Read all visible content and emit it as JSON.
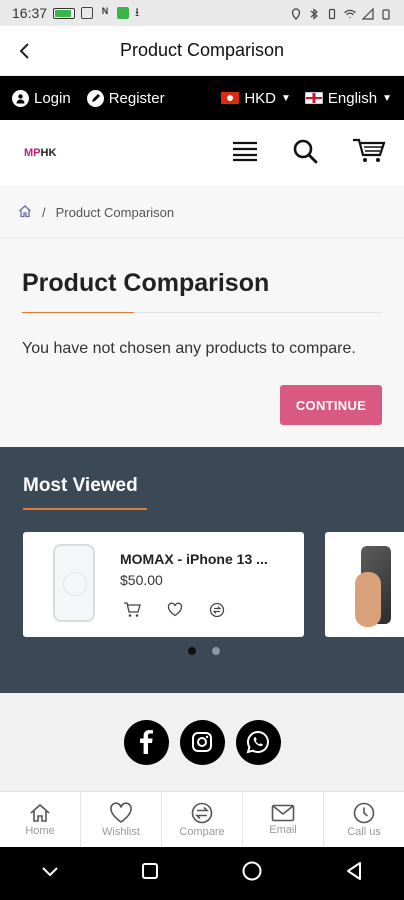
{
  "status_bar": {
    "time": "16:37"
  },
  "app_bar": {
    "title": "Product Comparison"
  },
  "top_bar": {
    "login_label": "Login",
    "register_label": "Register",
    "currency": "HKD",
    "language": "English"
  },
  "header": {
    "logo_text_m": "MP",
    "logo_text_hk": "HK"
  },
  "breadcrumb": {
    "separator": "/",
    "current": "Product Comparison"
  },
  "main": {
    "heading": "Product Comparison",
    "message": "You have not chosen any products to compare.",
    "continue_label": "CONTINUE"
  },
  "most_viewed": {
    "heading": "Most Viewed",
    "products": [
      {
        "name": "MOMAX - iPhone 13 ...",
        "price": "$50.00"
      }
    ]
  },
  "bottom_nav": {
    "items": [
      {
        "label": "Home",
        "icon": "home-icon"
      },
      {
        "label": "Wishlist",
        "icon": "heart-icon"
      },
      {
        "label": "Compare",
        "icon": "compare-icon"
      },
      {
        "label": "Email",
        "icon": "mail-icon"
      },
      {
        "label": "Call us",
        "icon": "phone-icon"
      }
    ]
  },
  "colors": {
    "accent_pink": "#d85a82",
    "accent_orange": "#e07a3a",
    "section_dark": "#3b4856"
  }
}
